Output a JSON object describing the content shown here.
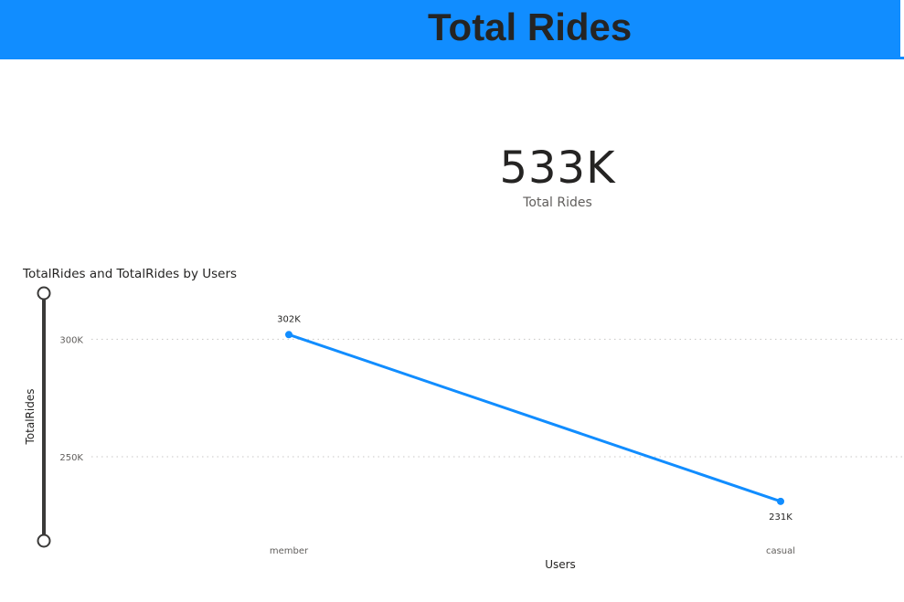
{
  "header": {
    "title": "Total Rides",
    "color": "#118dff"
  },
  "card": {
    "value": "533K",
    "label": "Total Rides"
  },
  "chart_data": {
    "type": "line",
    "title": "TotalRides and TotalRides by Users",
    "xlabel": "Users",
    "ylabel": "TotalRides",
    "categories": [
      "member",
      "casual"
    ],
    "series": [
      {
        "values": [
          302000,
          231000
        ],
        "data_labels": [
          "302K",
          "231K"
        ],
        "color": "#118dff"
      }
    ],
    "y_ticks": [
      {
        "value": 250000,
        "label": "250K"
      },
      {
        "value": 300000,
        "label": "300K"
      }
    ],
    "ylim": [
      215000,
      320000
    ],
    "grid": true
  }
}
